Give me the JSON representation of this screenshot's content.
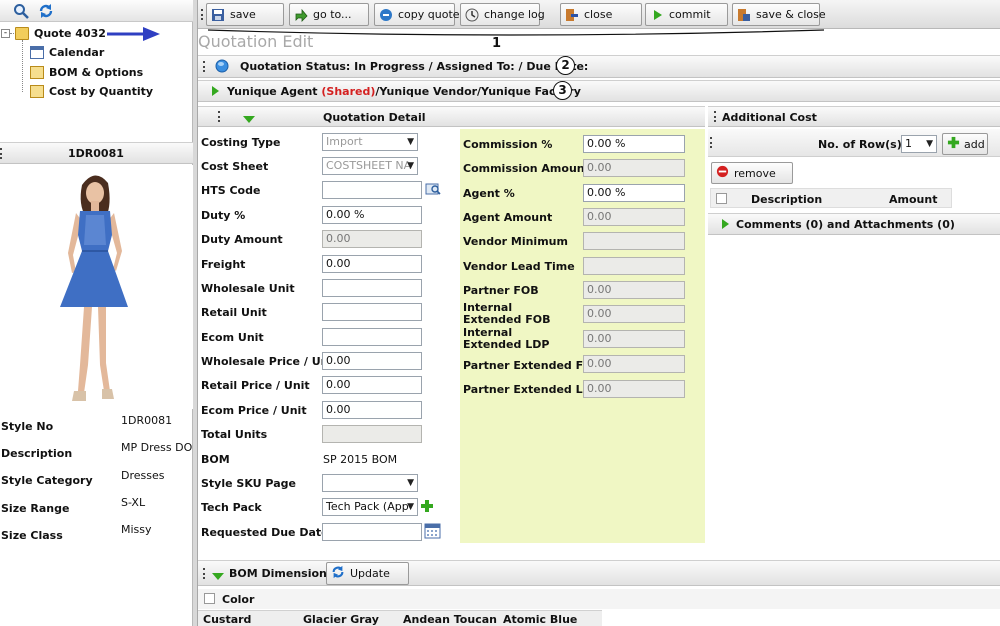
{
  "left_panel": {
    "tree": {
      "root_label": "Quote 4032",
      "items": [
        {
          "label": "Calendar",
          "icon": "calendar-icon"
        },
        {
          "label": "BOM & Options",
          "icon": "document-icon"
        },
        {
          "label": "Cost by Quantity",
          "icon": "document-icon"
        }
      ]
    },
    "style_header": "1DR0081",
    "attributes": [
      {
        "label": "Style No",
        "value": "1DR0081"
      },
      {
        "label": "Description",
        "value": "MP Dress DO N"
      },
      {
        "label": "Style Category",
        "value": "Dresses"
      },
      {
        "label": "Size Range",
        "value": "S-XL"
      },
      {
        "label": "Size Class",
        "value": "Missy"
      }
    ]
  },
  "toolbar": {
    "buttons": [
      {
        "label": "save",
        "icon": "save-icon"
      },
      {
        "label": "go to...",
        "icon": "goto-icon"
      },
      {
        "label": "copy quote",
        "icon": "copy-icon"
      },
      {
        "label": "change log",
        "icon": "changelog-icon"
      },
      {
        "label": "close",
        "icon": "close-icon"
      },
      {
        "label": "commit",
        "icon": "commit-icon"
      },
      {
        "label": "save & close",
        "icon": "save-close-icon"
      }
    ],
    "annotation": "1"
  },
  "page_title": "Quotation Edit",
  "status_bar": {
    "text": "Quotation Status: In Progress / Assigned To: / Due Date:",
    "annotation": "2"
  },
  "parties_bar": {
    "agent": "Yunique Agent",
    "shared": "(Shared)",
    "rest": "/Yunique Vendor/Yunique Factory",
    "annotation": "3"
  },
  "quotation_detail": {
    "title": "Quotation Detail",
    "left_fields": [
      {
        "label": "Costing Type",
        "value": "Import",
        "kind": "select-disabled"
      },
      {
        "label": "Cost Sheet",
        "value": "COSTSHEET NA",
        "kind": "select-disabled"
      },
      {
        "label": "HTS Code",
        "value": "",
        "kind": "input-lookup"
      },
      {
        "label": "Duty %",
        "value": "0.00 %",
        "kind": "input"
      },
      {
        "label": "Duty Amount",
        "value": "0.00",
        "kind": "disabled"
      },
      {
        "label": "Freight",
        "value": "0.00",
        "kind": "input"
      },
      {
        "label": "Wholesale Unit",
        "value": "",
        "kind": "input"
      },
      {
        "label": "Retail Unit",
        "value": "",
        "kind": "input"
      },
      {
        "label": "Ecom Unit",
        "value": "",
        "kind": "input"
      },
      {
        "label": "Wholesale Price / Unit",
        "value": "0.00",
        "kind": "input"
      },
      {
        "label": "Retail Price / Unit",
        "value": "0.00",
        "kind": "input"
      },
      {
        "label": "Ecom Price / Unit",
        "value": "0.00",
        "kind": "input"
      },
      {
        "label": "Total Units",
        "value": "",
        "kind": "disabled"
      },
      {
        "label": "BOM",
        "value": "SP 2015 BOM",
        "kind": "text"
      },
      {
        "label": "Style SKU Page",
        "value": "",
        "kind": "select"
      },
      {
        "label": "Tech Pack",
        "value": "Tech Pack (App",
        "kind": "select-add"
      },
      {
        "label": "Requested Due Date",
        "value": "",
        "kind": "input-date"
      }
    ],
    "right_fields": [
      {
        "label": "Commission %",
        "value": "0.00 %",
        "kind": "input"
      },
      {
        "label": "Commission Amount",
        "value": "0.00",
        "kind": "disabled"
      },
      {
        "label": "Agent %",
        "value": "0.00 %",
        "kind": "input"
      },
      {
        "label": "Agent Amount",
        "value": "0.00",
        "kind": "disabled"
      },
      {
        "label": "Vendor Minimum",
        "value": "",
        "kind": "disabled"
      },
      {
        "label": "Vendor Lead Time",
        "value": "",
        "kind": "disabled"
      },
      {
        "label": "Partner FOB",
        "value": "0.00",
        "kind": "disabled"
      },
      {
        "label": "Internal Extended FOB",
        "value": "0.00",
        "kind": "disabled"
      },
      {
        "label": "Internal Extended LDP",
        "value": "0.00",
        "kind": "disabled"
      },
      {
        "label": "Partner Extended FOB",
        "value": "0.00",
        "kind": "disabled"
      },
      {
        "label": "Partner Extended LDP",
        "value": "0.00",
        "kind": "disabled"
      }
    ]
  },
  "additional_cost": {
    "title": "Additional Cost",
    "rows_label": "No. of Row(s):",
    "rows_value": "1",
    "add_label": "add",
    "remove_label": "remove",
    "columns": [
      "Description",
      "Amount"
    ],
    "comments_label": "Comments (0) and Attachments (0)"
  },
  "bom_dimensions": {
    "title": "BOM Dimensions",
    "update_label": "Update",
    "color_label": "Color",
    "colors": [
      "Custard",
      "Glacier Gray",
      "Andean Toucan",
      "Atomic Blue"
    ]
  },
  "colors": {
    "accent_green": "#34a81f",
    "yellow_panel": "#f0f7c4",
    "shared_red": "#d42020",
    "arrow_blue": "#2f3fc2"
  }
}
